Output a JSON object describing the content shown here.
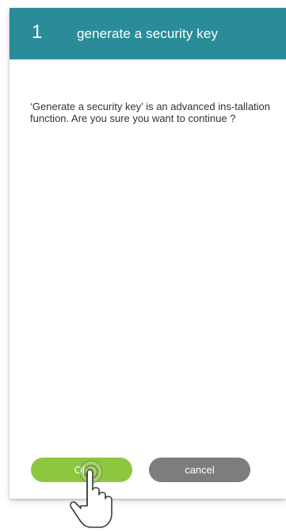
{
  "dialog": {
    "step_number": "1",
    "title": "generate a security key",
    "message": "‘Generate a security key’ is an advanced ins-tallation function. Are you sure you want to continue ?"
  },
  "buttons": {
    "ok_label": "OK",
    "cancel_label": "cancel"
  },
  "colors": {
    "header": "#2a8c99",
    "ok_button": "#8dc63f",
    "cancel_button": "#7d7d7d"
  },
  "icons": {
    "pointer": "tap-hand-icon"
  }
}
